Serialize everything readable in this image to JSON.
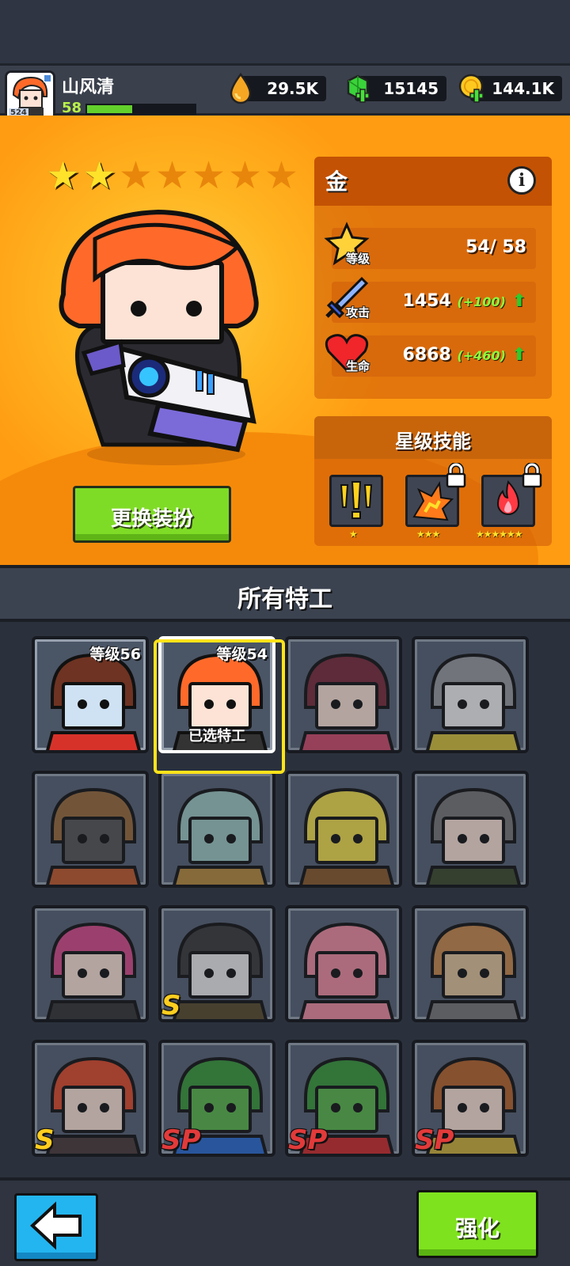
{
  "player": {
    "name": "山风清",
    "level": "58",
    "avatar_badge": "524",
    "xp_fraction": 0.42
  },
  "resources": {
    "oil": "29.5K",
    "gems": "15145",
    "coins": "144.1K"
  },
  "hero": {
    "stars_total": 7,
    "stars_filled": 2,
    "change_outfit_label": "更换装扮"
  },
  "stats": {
    "title": "金",
    "level_label": "等级",
    "level_value": "54/ 58",
    "attack_label": "攻击",
    "attack_value": "1454",
    "attack_bonus": "(+100)",
    "hp_label": "生命",
    "hp_value": "6868",
    "hp_bonus": "(+460)"
  },
  "skills": {
    "title": "星级技能",
    "items": [
      {
        "icon": "exclamation-skill-icon",
        "stars": "★",
        "locked": false
      },
      {
        "icon": "explosion-skill-icon",
        "stars": "★★★",
        "locked": true
      },
      {
        "icon": "fire-skill-icon",
        "stars": "★★★★★★",
        "locked": true
      }
    ]
  },
  "roster": {
    "title": "所有特工",
    "cards": [
      {
        "name": "goggles-agent",
        "level": "等级56",
        "tag": ""
      },
      {
        "name": "red-hair-agent",
        "level": "等级54",
        "tag": "已选特工"
      },
      {
        "name": "pink-scarf-agent",
        "level": "",
        "tag": ""
      },
      {
        "name": "cat-agent",
        "level": "",
        "tag": ""
      },
      {
        "name": "hooded-robot-agent",
        "level": "",
        "tag": ""
      },
      {
        "name": "squidward-agent",
        "level": "",
        "tag": ""
      },
      {
        "name": "spongebob-agent",
        "level": "",
        "tag": ""
      },
      {
        "name": "eyepatch-agent",
        "level": "",
        "tag": ""
      },
      {
        "name": "pink-hair-agent",
        "level": "",
        "tag": ""
      },
      {
        "name": "panda-agent",
        "level": "",
        "tag": "",
        "rank": "S"
      },
      {
        "name": "patrick-agent",
        "level": "",
        "tag": ""
      },
      {
        "name": "sandy-agent",
        "level": "",
        "tag": ""
      },
      {
        "name": "musician-agent",
        "level": "",
        "tag": "",
        "rank": "S"
      },
      {
        "name": "leonardo-agent",
        "level": "",
        "tag": "",
        "rank": "SP"
      },
      {
        "name": "raphael-agent",
        "level": "",
        "tag": "",
        "rank": "SP"
      },
      {
        "name": "april-agent",
        "level": "",
        "tag": "",
        "rank": "SP"
      }
    ]
  },
  "footer": {
    "back_icon": "back-arrow-icon",
    "enhance_label": "强化"
  }
}
